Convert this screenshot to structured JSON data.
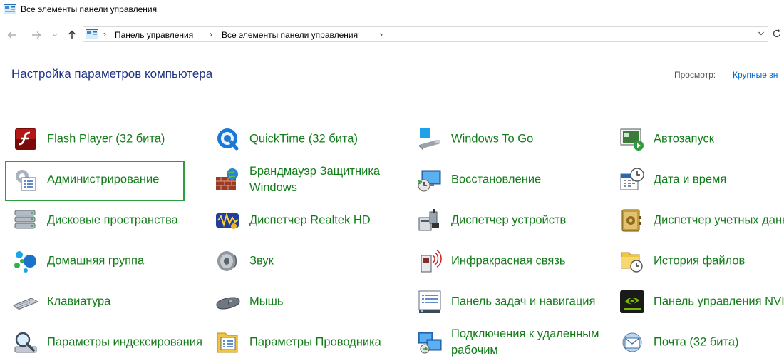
{
  "window": {
    "title": "Все элементы панели управления"
  },
  "address": {
    "crumbs": [
      "Панель управления",
      "Все элементы панели управления"
    ]
  },
  "header": {
    "heading": "Настройка параметров компьютера",
    "view_label": "Просмотр:",
    "view_value": "Крупные зн"
  },
  "items": [
    {
      "label": "Flash Player (32 бита)",
      "icon": "flash-player-icon"
    },
    {
      "label": "QuickTime (32 бита)",
      "icon": "quicktime-icon"
    },
    {
      "label": "Windows To Go",
      "icon": "windows-to-go-icon"
    },
    {
      "label": "Автозапуск",
      "icon": "autoplay-icon"
    },
    {
      "label": "Администрирование",
      "icon": "administration-icon",
      "highlighted": true
    },
    {
      "label": "Брандмауэр Защитника Windows",
      "icon": "firewall-icon"
    },
    {
      "label": "Восстановление",
      "icon": "recovery-icon"
    },
    {
      "label": "Дата и время",
      "icon": "date-time-icon"
    },
    {
      "label": "Дисковые пространства",
      "icon": "storage-spaces-icon"
    },
    {
      "label": "Диспетчер Realtek HD",
      "icon": "realtek-icon"
    },
    {
      "label": "Диспетчер устройств",
      "icon": "device-manager-icon"
    },
    {
      "label": "Диспетчер учетных данных",
      "icon": "credential-manager-icon"
    },
    {
      "label": "Домашняя группа",
      "icon": "homegroup-icon"
    },
    {
      "label": "Звук",
      "icon": "sound-icon"
    },
    {
      "label": "Инфракрасная связь",
      "icon": "infrared-icon"
    },
    {
      "label": "История файлов",
      "icon": "file-history-icon"
    },
    {
      "label": "Клавиатура",
      "icon": "keyboard-icon"
    },
    {
      "label": "Мышь",
      "icon": "mouse-icon"
    },
    {
      "label": "Панель задач и навигация",
      "icon": "taskbar-icon"
    },
    {
      "label": "Панель управления NVIDIA",
      "icon": "nvidia-icon"
    },
    {
      "label": "Параметры индексирования",
      "icon": "indexing-icon"
    },
    {
      "label": "Параметры Проводника",
      "icon": "explorer-options-icon"
    },
    {
      "label": "Подключения к удаленным рабочим",
      "icon": "remote-connections-icon"
    },
    {
      "label": "Почта (32 бита)",
      "icon": "mail-icon"
    }
  ],
  "colors": {
    "link": "#127c19",
    "heading": "#1e3287",
    "highlight": "#2e9b3d"
  }
}
